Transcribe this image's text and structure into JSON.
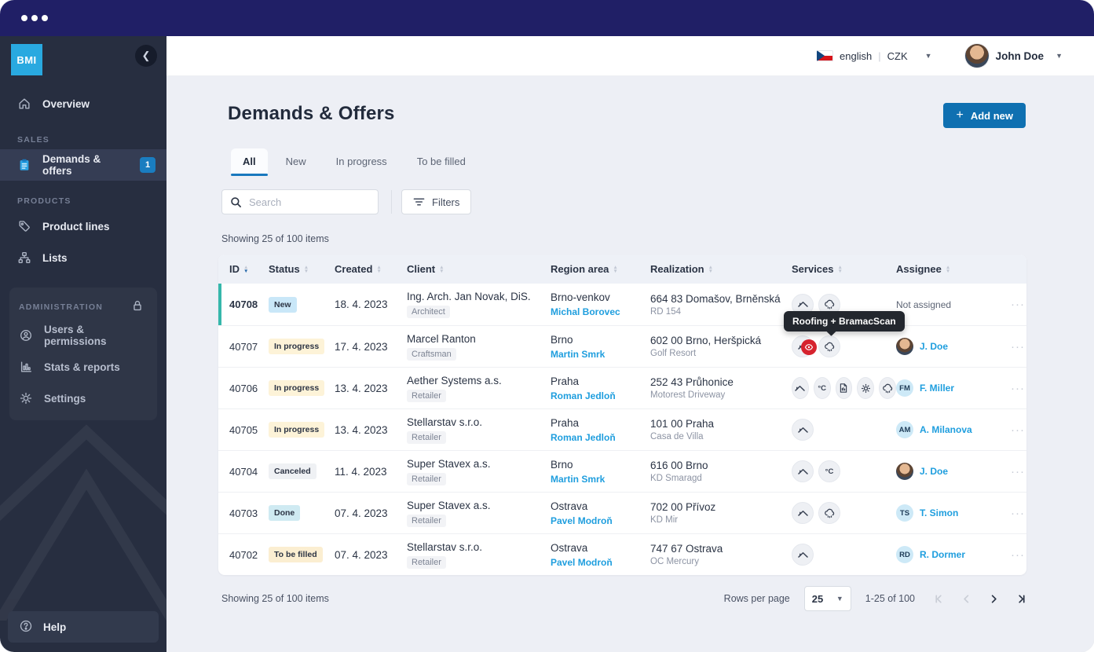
{
  "topbar": {
    "window_dots": 3
  },
  "sidebar": {
    "logo_text": "BMI",
    "groups": [
      {
        "label": null,
        "items": [
          {
            "icon": "home",
            "label": "Overview"
          }
        ]
      },
      {
        "label": "SALES",
        "items": [
          {
            "icon": "clipboard",
            "label": "Demands & offers",
            "badge": "1",
            "active": true
          }
        ]
      },
      {
        "label": "PRODUCTS",
        "items": [
          {
            "icon": "tag",
            "label": "Product lines"
          },
          {
            "icon": "tree",
            "label": "Lists"
          }
        ]
      },
      {
        "label": "ADMINISTRATION",
        "locked": true,
        "panel": true,
        "items": [
          {
            "icon": "user",
            "label": "Users & permissions"
          },
          {
            "icon": "chart",
            "label": "Stats & reports"
          },
          {
            "icon": "gear",
            "label": "Settings"
          }
        ]
      }
    ],
    "help_label": "Help"
  },
  "header": {
    "language": "english",
    "currency": "CZK",
    "user_name": "John Doe"
  },
  "page": {
    "title": "Demands & Offers",
    "add_new_label": "Add new",
    "tabs": [
      {
        "label": "All",
        "active": true
      },
      {
        "label": "New",
        "active": false
      },
      {
        "label": "In progress",
        "active": false
      },
      {
        "label": "To be filled",
        "active": false
      }
    ],
    "search_placeholder": "Search",
    "filters_label": "Filters",
    "showing_text": "Showing 25 of 100 items"
  },
  "table": {
    "columns": [
      {
        "label": "ID",
        "sorted": true
      },
      {
        "label": "Status",
        "sorted": false
      },
      {
        "label": "Created",
        "sorted": false
      },
      {
        "label": "Client",
        "sorted": false
      },
      {
        "label": "Region area",
        "sorted": false
      },
      {
        "label": "Realization",
        "sorted": false
      },
      {
        "label": "Services",
        "sorted": false
      },
      {
        "label": "Assignee",
        "sorted": false
      }
    ],
    "rows": [
      {
        "id": "40708",
        "status": "New",
        "status_type": "new",
        "created": "18. 4. 2023",
        "client": "Ing. Arch. Jan Novak, DiS.",
        "client_type": "Architect",
        "region": "Brno-venkov",
        "region_contact": "Michal Borovec",
        "realization": "664 83 Domašov, Brněnská",
        "realization_sub": "RD 154",
        "services": [
          "roof",
          "cloud"
        ],
        "assignee": {
          "type": "none",
          "name": "Not assigned"
        },
        "selected": true
      },
      {
        "id": "40707",
        "status": "In progress",
        "status_type": "progress",
        "created": "17. 4. 2023",
        "client": "Marcel Ranton",
        "client_type": "Craftsman",
        "region": "Brno",
        "region_contact": "Martin Smrk",
        "realization": "602 00 Brno, Heršpická",
        "realization_sub": "Golf Resort",
        "services": [
          "roof-scan",
          "cloud"
        ],
        "assignee": {
          "type": "photo",
          "name": "J. Doe"
        },
        "tooltip": "Roofing + BramacScan"
      },
      {
        "id": "40706",
        "status": "In progress",
        "status_type": "progress",
        "created": "13. 4. 2023",
        "client": "Aether Systems a.s.",
        "client_type": "Retailer",
        "region": "Praha",
        "region_contact": "Roman Jedloň",
        "realization": "252 43 Průhonice",
        "realization_sub": "Motorest Driveway",
        "services": [
          "roof",
          "temp",
          "doc",
          "sun",
          "cloud"
        ],
        "assignee": {
          "type": "initials",
          "initials": "FM",
          "name": "F. Miller"
        }
      },
      {
        "id": "40705",
        "status": "In progress",
        "status_type": "progress",
        "created": "13. 4. 2023",
        "client": "Stellarstav s.r.o.",
        "client_type": "Retailer",
        "region": "Praha",
        "region_contact": "Roman Jedloň",
        "realization": "101 00 Praha",
        "realization_sub": "Casa de Villa",
        "services": [
          "roof"
        ],
        "assignee": {
          "type": "initials",
          "initials": "AM",
          "name": "A. Milanova"
        }
      },
      {
        "id": "40704",
        "status": "Canceled",
        "status_type": "canceled",
        "created": "11. 4. 2023",
        "client": "Super Stavex a.s.",
        "client_type": "Retailer",
        "region": "Brno",
        "region_contact": "Martin Smrk",
        "realization": "616 00 Brno",
        "realization_sub": "KD Smaragd",
        "services": [
          "roof",
          "temp"
        ],
        "assignee": {
          "type": "photo",
          "name": "J. Doe"
        }
      },
      {
        "id": "40703",
        "status": "Done",
        "status_type": "done",
        "created": "07. 4. 2023",
        "client": "Super Stavex a.s.",
        "client_type": "Retailer",
        "region": "Ostrava",
        "region_contact": "Pavel Modroň",
        "realization": "702 00 Přívoz",
        "realization_sub": "KD Mir",
        "services": [
          "roof",
          "cloud"
        ],
        "assignee": {
          "type": "initials",
          "initials": "TS",
          "name": "T. Simon"
        }
      },
      {
        "id": "40702",
        "status": "To be filled",
        "status_type": "tofill",
        "created": "07. 4. 2023",
        "client": "Stellarstav s.r.o.",
        "client_type": "Retailer",
        "region": "Ostrava",
        "region_contact": "Pavel Modroň",
        "realization": "747 67 Ostrava",
        "realization_sub": "OC Mercury",
        "services": [
          "roof"
        ],
        "assignee": {
          "type": "initials",
          "initials": "RD",
          "name": "R. Dormer"
        }
      }
    ]
  },
  "footer": {
    "showing_text": "Showing 25 of 100 items",
    "rows_per_page_label": "Rows per page",
    "rows_per_page_value": "25",
    "range_text": "1-25 of 100"
  },
  "colors": {
    "topbar": "#201f66",
    "sidebar": "#272e40",
    "accent_blue": "#0f70b1",
    "link_blue": "#1f9ede",
    "badge_blue": "#1a7dc0",
    "selected_row_border": "#36b7ab",
    "tooltip_bg": "#23272e",
    "status_new": "#c9e7f8",
    "status_progress": "#fdf3d8",
    "status_canceled": "#eff1f4",
    "status_done": "#cfeaf2",
    "status_tofill": "#fbeed1"
  }
}
